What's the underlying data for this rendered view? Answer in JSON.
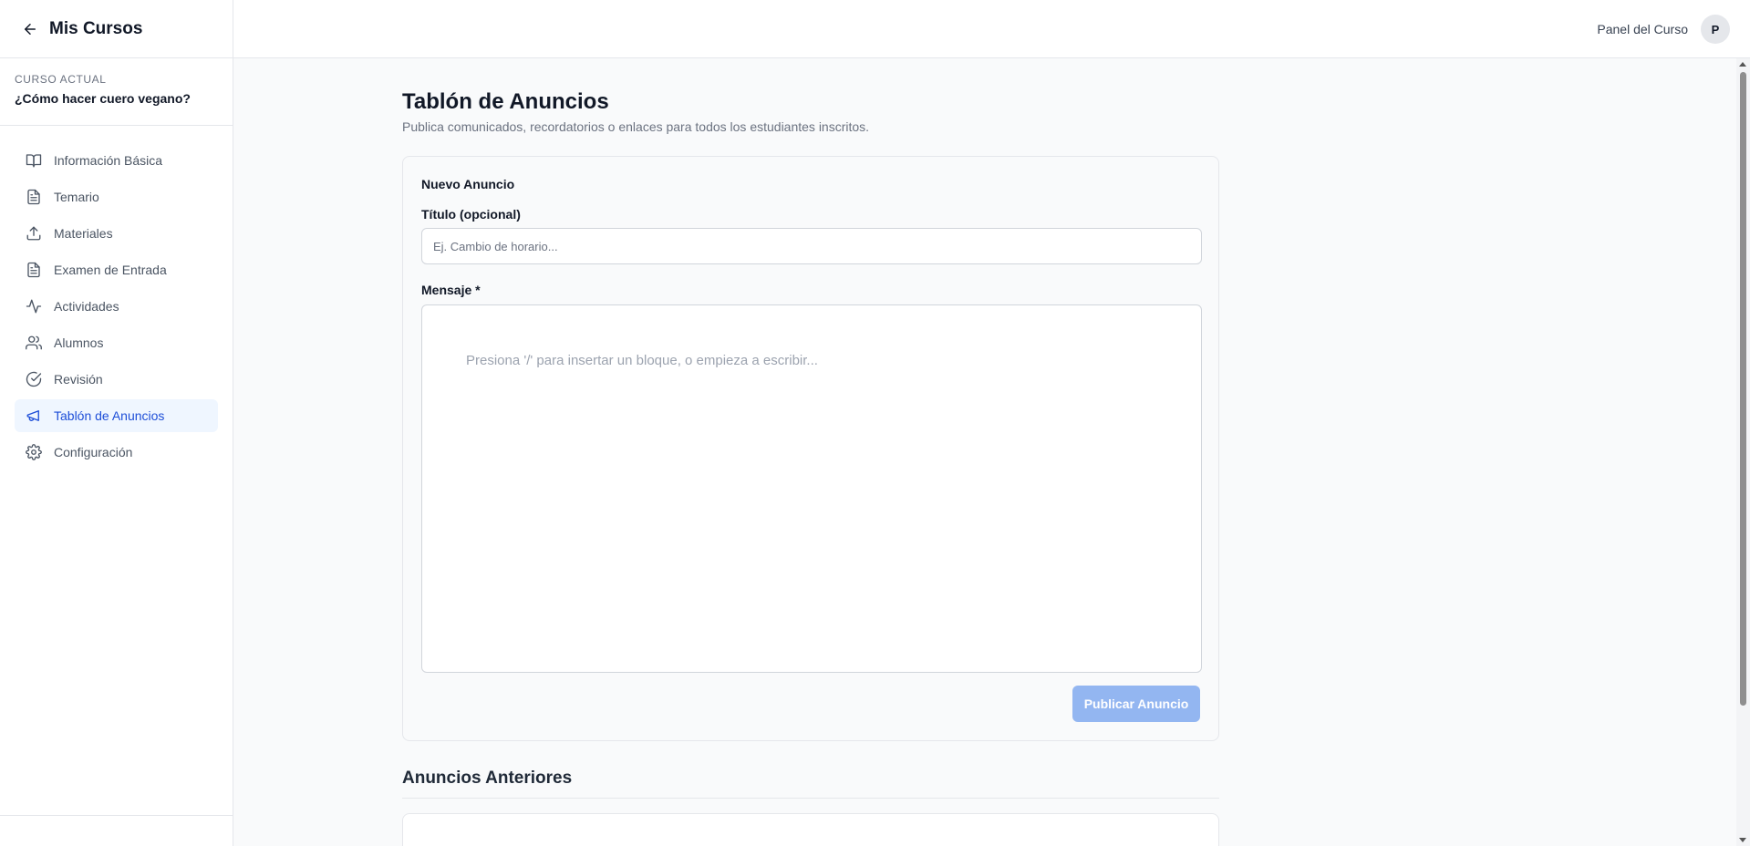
{
  "sidebar": {
    "back_label": "Mis Cursos",
    "course_label": "CURSO ACTUAL",
    "course_name": "¿Cómo hacer cuero vegano?",
    "items": [
      {
        "label": "Información Básica",
        "icon": "book-open-icon"
      },
      {
        "label": "Temario",
        "icon": "file-text-icon"
      },
      {
        "label": "Materiales",
        "icon": "upload-icon"
      },
      {
        "label": "Examen de Entrada",
        "icon": "file-text-icon"
      },
      {
        "label": "Actividades",
        "icon": "activity-icon"
      },
      {
        "label": "Alumnos",
        "icon": "users-icon"
      },
      {
        "label": "Revisión",
        "icon": "check-circle-icon"
      },
      {
        "label": "Tablón de Anuncios",
        "icon": "megaphone-icon",
        "active": true
      },
      {
        "label": "Configuración",
        "icon": "gear-icon"
      }
    ]
  },
  "header": {
    "panel_label": "Panel del Curso",
    "avatar_initial": "P"
  },
  "main": {
    "title": "Tablón de Anuncios",
    "subtitle": "Publica comunicados, recordatorios o enlaces para todos los estudiantes inscritos.",
    "form": {
      "card_title": "Nuevo Anuncio",
      "title_label": "Título (opcional)",
      "title_placeholder": "Ej. Cambio de horario...",
      "title_value": "",
      "message_label": "Mensaje *",
      "message_placeholder": "Presiona '/' para insertar un bloque, o empieza a escribir...",
      "publish_label": "Publicar Anuncio"
    },
    "previous_title": "Anuncios Anteriores"
  },
  "colors": {
    "accent": "#1d4ed8",
    "active_bg": "#eff6ff",
    "button_disabled": "#93b6f1"
  }
}
